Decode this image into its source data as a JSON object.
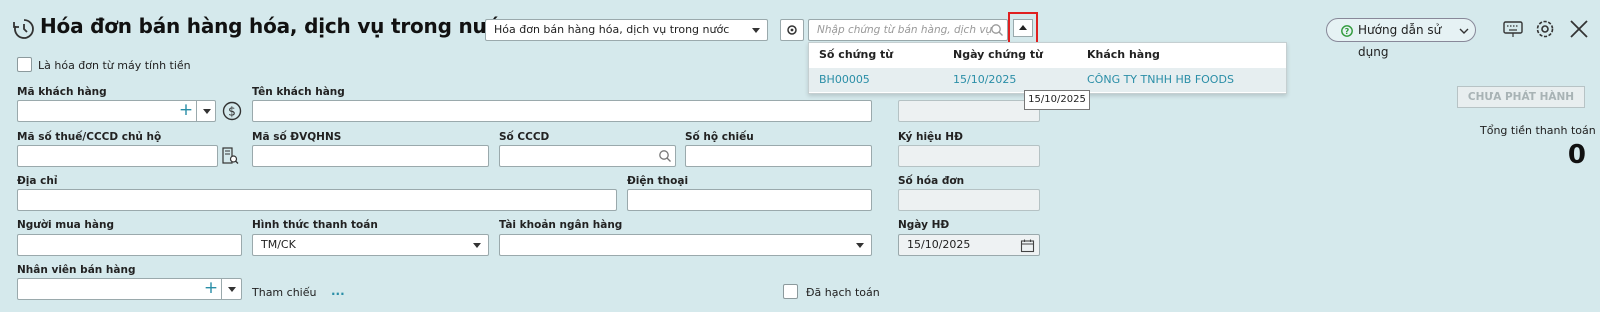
{
  "header": {
    "title": "Hóa đơn bán hàng hóa, dịch vụ trong nước",
    "invoice_type_value": "Hóa đơn bán hàng hóa, dịch vụ trong nước",
    "search_placeholder": "Nhập chứng từ bán hàng, dịch vụ",
    "help_label": "Hướng dẫn sử dụng"
  },
  "dropdown": {
    "columns": [
      "Số chứng từ",
      "Ngày chứng từ",
      "Khách hàng"
    ],
    "rows": [
      {
        "doc_no": "BH00005",
        "doc_date": "15/10/2025",
        "customer": "CÔNG TY TNHH HB FOODS"
      }
    ],
    "tooltip": "15/10/2025"
  },
  "form": {
    "cash_register_label": "Là hóa đơn từ máy tính tiền",
    "customer_code_label": "Mã khách hàng",
    "customer_name_label": "Tên khách hàng",
    "tax_code_label": "Mã số thuế/CCCD chủ hộ",
    "budget_code_label": "Mã số ĐVQHNS",
    "id_no_label": "Số CCCD",
    "passport_label": "Số hộ chiếu",
    "address_label": "Địa chỉ",
    "phone_label": "Điện thoại",
    "buyer_label": "Người mua hàng",
    "payment_method_label": "Hình thức thanh toán",
    "payment_method_value": "TM/CK",
    "bank_account_label": "Tài khoản ngân hàng",
    "salesperson_label": "Nhân viên bán hàng",
    "reference_label": "Tham chiếu",
    "reference_link": "...",
    "posted_label": "Đã hạch toán"
  },
  "invoice": {
    "symbol_label": "Ký hiệu HĐ",
    "number_label": "Số hóa đơn",
    "date_label": "Ngày HĐ",
    "date_value": "15/10/2025"
  },
  "summary": {
    "status_label": "CHƯA PHÁT HÀNH",
    "total_label": "Tổng tiền thanh toán",
    "total_value": "0"
  },
  "colors": {
    "background": "#d5e9ec",
    "link": "#2a8ea7",
    "highlight": "#e02020"
  }
}
